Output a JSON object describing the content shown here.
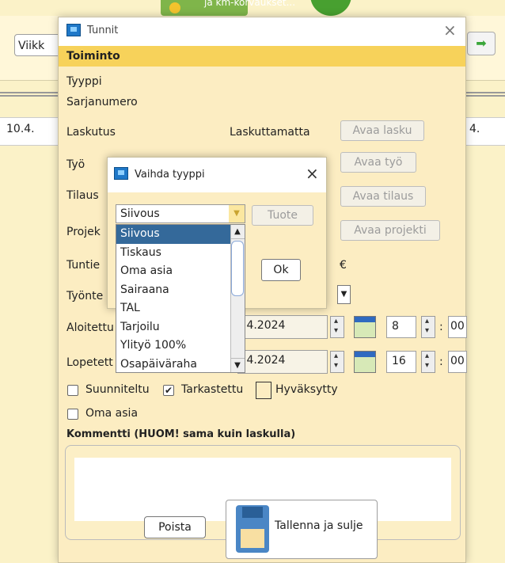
{
  "background": {
    "banner_text": "ja km-korvaukset...",
    "week_select": "Viikk",
    "date_left": "10.4.",
    "date_right": "4."
  },
  "dialog": {
    "title": "Tunnit",
    "section": "Toiminto",
    "rows": {
      "tyyppi": "Tyyppi",
      "sarjanumero": "Sarjanumero",
      "laskutus": "Laskutus",
      "laskutus_status": "Laskuttamatta",
      "avaa_lasku": "Avaa lasku",
      "tyo": "Työ",
      "avaa_tyo": "Avaa työ",
      "tilaus": "Tilaus",
      "avaa_tilaus": "Avaa tilaus",
      "projekti": "Projek",
      "avaa_projekti": "Avaa projekti",
      "tuntie": "Tuntie",
      "currency": "€",
      "tyonte": "Työnte",
      "aloitettu": "Aloitettu",
      "aloitettu_date": ".4.2024",
      "aloitettu_hour": "8",
      "aloitettu_min": "00",
      "lopetettu": "Lopetett",
      "lopetettu_date": ".4.2024",
      "lopetettu_hour": "16",
      "lopetettu_min": "00"
    },
    "checks": {
      "suunniteltu": "Suunniteltu",
      "tarkastettu": "Tarkastettu",
      "hyvaksytty": "Hyväksytty",
      "oma_asia": "Oma asia"
    },
    "comment_label": "Kommentti (HUOM! sama kuin laskulla)",
    "delete_label": "Poista",
    "save_label": "Tallenna ja sulje"
  },
  "type_dialog": {
    "title": "Vaihda tyyppi",
    "selected": "Siivous",
    "tuote_label": "Tuote",
    "ok_label": "Ok",
    "options": [
      "Siivous",
      "Tiskaus",
      "Oma asia",
      "Sairaana",
      "TAL",
      "Tarjoilu",
      "Ylityö 100%",
      "Osapäiväraha"
    ]
  }
}
